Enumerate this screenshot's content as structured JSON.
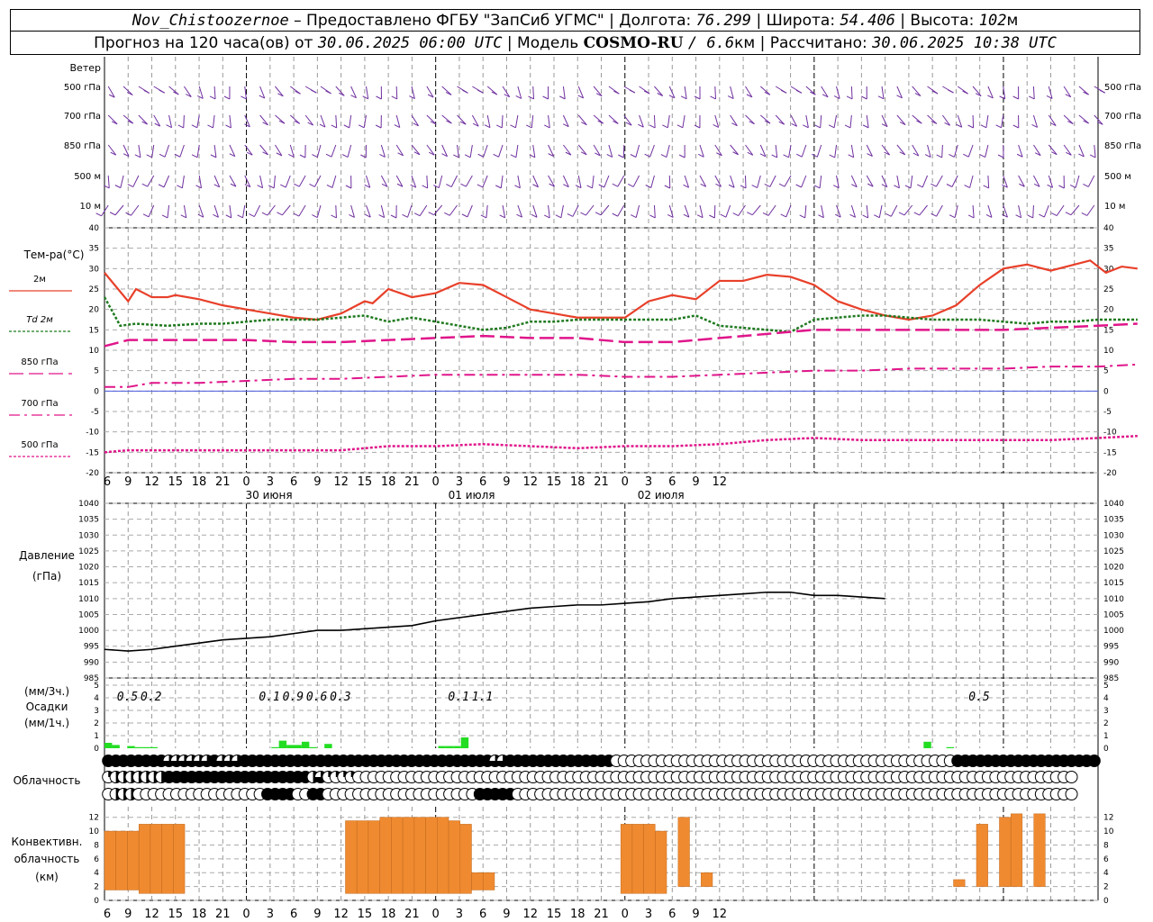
{
  "header": {
    "station": "Nov_Chistoozernoe",
    "provider": "– Предоставлено ФГБУ \"ЗапСиб УГМС\" |",
    "lon_label": "Долгота:",
    "lon_value": "76.299",
    "lat_label": "| Широта:",
    "lat_value": "54.406",
    "alt_label": "| Высота:",
    "alt_value": "102",
    "alt_unit": "м",
    "forecast_label": "Прогноз на 120 часа(ов) от",
    "forecast_from": "30.06.2025 06:00 UTC",
    "model_label": "| Модель",
    "model_name": "COSMO-RU",
    "model_res": "/ 6.6",
    "model_res_unit": "км",
    "calc_label": "| Рассчитано:",
    "calc_time": "30.06.2025 10:38 UTC"
  },
  "colors": {
    "wind": "#7030a0",
    "t2m": "#e8402a",
    "td2m": "#1f7a1f",
    "t850": "#e0158a",
    "t700": "#e0158a",
    "t500": "#e0158a",
    "precip": "#22dd22",
    "convective": "#f08a30",
    "pressure": "#000000",
    "zero_line": "#4a5ae0"
  },
  "chart_data": {
    "type": "meteogram",
    "hour_ticks": [
      "6",
      "9",
      "12",
      "15",
      "18",
      "21",
      "0",
      "3",
      "6",
      "9",
      "12",
      "15",
      "18",
      "21",
      "0",
      "3",
      "6",
      "9",
      "12",
      "15",
      "18",
      "21",
      "0",
      "3",
      "6",
      "9",
      "12"
    ],
    "day_labels": [
      {
        "text": "30 июня",
        "hour": 6
      },
      {
        "text": "01 июля",
        "hour": 42
      },
      {
        "text": "02 июля",
        "hour": 66
      }
    ],
    "wind_panel": {
      "title": "Ветер",
      "levels": [
        "500 гПа",
        "700 гПа",
        "850 гПа",
        "500 м",
        "10  м"
      ]
    },
    "temperature": {
      "title": "Тем-ра(°С)",
      "ylim": [
        -20,
        40
      ],
      "ticks": [
        40,
        35,
        30,
        25,
        20,
        15,
        10,
        5,
        0,
        -5,
        -10,
        -15,
        -20
      ],
      "series": [
        {
          "name": "2м",
          "style": "solid",
          "points": [
            [
              0,
              29
            ],
            [
              3,
              22
            ],
            [
              4,
              25
            ],
            [
              6,
              23
            ],
            [
              8,
              23
            ],
            [
              9,
              23.5
            ],
            [
              12,
              22.5
            ],
            [
              15,
              21
            ],
            [
              18,
              20
            ],
            [
              21,
              19
            ],
            [
              24,
              18
            ],
            [
              27,
              17.5
            ],
            [
              30,
              19
            ],
            [
              33,
              22
            ],
            [
              34,
              21.5
            ],
            [
              36,
              25
            ],
            [
              39,
              23
            ],
            [
              42,
              24
            ],
            [
              45,
              26.5
            ],
            [
              48,
              26
            ],
            [
              51,
              23
            ],
            [
              54,
              20
            ],
            [
              57,
              19
            ],
            [
              60,
              18
            ],
            [
              63,
              18
            ],
            [
              66,
              18
            ],
            [
              69,
              22
            ],
            [
              72,
              23.5
            ],
            [
              75,
              22.5
            ],
            [
              78,
              27
            ],
            [
              81,
              27
            ],
            [
              84,
              28.5
            ],
            [
              87,
              28
            ],
            [
              90,
              26
            ],
            [
              93,
              22
            ],
            [
              96,
              20
            ],
            [
              99,
              18.5
            ],
            [
              102,
              17.5
            ],
            [
              105,
              18.5
            ],
            [
              108,
              21
            ],
            [
              111,
              26
            ],
            [
              114,
              30
            ],
            [
              117,
              31
            ],
            [
              120,
              29.5
            ],
            [
              123,
              31
            ],
            [
              125,
              32
            ],
            [
              127,
              29
            ],
            [
              129,
              30.5
            ],
            [
              131,
              30
            ]
          ]
        },
        {
          "name": "Td  2м",
          "style": "dotted",
          "points": [
            [
              0,
              23
            ],
            [
              2,
              16
            ],
            [
              4,
              16.5
            ],
            [
              8,
              16
            ],
            [
              12,
              16.5
            ],
            [
              15,
              16.5
            ],
            [
              18,
              17
            ],
            [
              21,
              17.5
            ],
            [
              24,
              17.5
            ],
            [
              27,
              17.5
            ],
            [
              30,
              18
            ],
            [
              33,
              18.5
            ],
            [
              36,
              17
            ],
            [
              39,
              18
            ],
            [
              42,
              17
            ],
            [
              45,
              16
            ],
            [
              48,
              15
            ],
            [
              51,
              15.5
            ],
            [
              54,
              17
            ],
            [
              57,
              17
            ],
            [
              60,
              17.5
            ],
            [
              63,
              17.5
            ],
            [
              66,
              17.5
            ],
            [
              69,
              17.5
            ],
            [
              72,
              17.5
            ],
            [
              75,
              18.5
            ],
            [
              78,
              16
            ],
            [
              81,
              15.5
            ],
            [
              84,
              15
            ],
            [
              87,
              14.5
            ],
            [
              90,
              17.5
            ],
            [
              93,
              18
            ],
            [
              96,
              18.5
            ],
            [
              99,
              18.5
            ],
            [
              102,
              18
            ],
            [
              105,
              17.5
            ],
            [
              108,
              17.5
            ],
            [
              111,
              17.5
            ],
            [
              114,
              17
            ],
            [
              117,
              16.5
            ],
            [
              120,
              17
            ],
            [
              123,
              17
            ],
            [
              126,
              17.5
            ],
            [
              131,
              17.5
            ]
          ]
        },
        {
          "name": "850 гПа",
          "style": "longdash",
          "points": [
            [
              0,
              11
            ],
            [
              3,
              12.5
            ],
            [
              6,
              12.5
            ],
            [
              12,
              12.5
            ],
            [
              18,
              12.5
            ],
            [
              24,
              12
            ],
            [
              30,
              12
            ],
            [
              36,
              12.5
            ],
            [
              42,
              13
            ],
            [
              48,
              13.5
            ],
            [
              54,
              13
            ],
            [
              60,
              13
            ],
            [
              66,
              12
            ],
            [
              72,
              12
            ],
            [
              78,
              13
            ],
            [
              84,
              14
            ],
            [
              90,
              15
            ],
            [
              96,
              15
            ],
            [
              102,
              15
            ],
            [
              108,
              15
            ],
            [
              114,
              15
            ],
            [
              120,
              15.5
            ],
            [
              126,
              16
            ],
            [
              131,
              16.5
            ]
          ]
        },
        {
          "name": "700 гПа",
          "style": "dashdot",
          "points": [
            [
              0,
              1
            ],
            [
              3,
              1
            ],
            [
              6,
              2
            ],
            [
              12,
              2
            ],
            [
              18,
              2.5
            ],
            [
              24,
              3
            ],
            [
              30,
              3
            ],
            [
              36,
              3.5
            ],
            [
              42,
              4
            ],
            [
              48,
              4
            ],
            [
              54,
              4
            ],
            [
              60,
              4
            ],
            [
              66,
              3.5
            ],
            [
              72,
              3.5
            ],
            [
              78,
              4
            ],
            [
              84,
              4.5
            ],
            [
              90,
              5
            ],
            [
              96,
              5
            ],
            [
              102,
              5.5
            ],
            [
              108,
              5.5
            ],
            [
              114,
              5.5
            ],
            [
              120,
              6
            ],
            [
              126,
              6
            ],
            [
              131,
              6.5
            ]
          ]
        },
        {
          "name": "500 гПа",
          "style": "dotted",
          "points": [
            [
              0,
              -15
            ],
            [
              3,
              -14.5
            ],
            [
              6,
              -14.5
            ],
            [
              12,
              -14.5
            ],
            [
              18,
              -14.5
            ],
            [
              24,
              -14.5
            ],
            [
              30,
              -14.5
            ],
            [
              36,
              -13.5
            ],
            [
              42,
              -13.5
            ],
            [
              48,
              -13
            ],
            [
              54,
              -13.5
            ],
            [
              60,
              -14
            ],
            [
              66,
              -13.5
            ],
            [
              72,
              -13.5
            ],
            [
              78,
              -13
            ],
            [
              84,
              -12
            ],
            [
              90,
              -11.5
            ],
            [
              96,
              -12
            ],
            [
              102,
              -12
            ],
            [
              108,
              -12
            ],
            [
              114,
              -12
            ],
            [
              120,
              -12
            ],
            [
              126,
              -11.5
            ],
            [
              131,
              -11
            ]
          ]
        }
      ]
    },
    "pressure": {
      "title": "Давление",
      "unit": "(гПа)",
      "ylim": [
        985,
        1040
      ],
      "ticks": [
        1040,
        1035,
        1030,
        1025,
        1020,
        1015,
        1010,
        1005,
        1000,
        995,
        990,
        985
      ],
      "points": [
        [
          0,
          994
        ],
        [
          3,
          993.5
        ],
        [
          6,
          994
        ],
        [
          9,
          995
        ],
        [
          12,
          996
        ],
        [
          15,
          997
        ],
        [
          18,
          997.5
        ],
        [
          21,
          998
        ],
        [
          24,
          999
        ],
        [
          27,
          1000
        ],
        [
          30,
          1000
        ],
        [
          33,
          1000.5
        ],
        [
          36,
          1001
        ],
        [
          39,
          1001.5
        ],
        [
          42,
          1003
        ],
        [
          45,
          1004
        ],
        [
          48,
          1005
        ],
        [
          51,
          1006
        ],
        [
          54,
          1007
        ],
        [
          57,
          1007.5
        ],
        [
          60,
          1008
        ],
        [
          63,
          1008
        ],
        [
          66,
          1008.5
        ],
        [
          69,
          1009
        ],
        [
          72,
          1010
        ],
        [
          75,
          1010.5
        ],
        [
          78,
          1011
        ],
        [
          81,
          1011.5
        ],
        [
          84,
          1012
        ],
        [
          87,
          1012
        ],
        [
          90,
          1011
        ],
        [
          93,
          1011
        ],
        [
          96,
          1010.5
        ],
        [
          99,
          1010
        ]
      ]
    },
    "precipitation": {
      "unit_3h": "(мм/3ч.)",
      "title": "Осадки",
      "unit_1h": "(мм/1ч.)",
      "ylim": [
        0,
        5
      ],
      "ticks": [
        5,
        4,
        3,
        2,
        1,
        0
      ],
      "totals": [
        {
          "hour": 2,
          "value": "0.5"
        },
        {
          "hour": 5,
          "value": "0.2"
        },
        {
          "hour": 20,
          "value": "0.1"
        },
        {
          "hour": 23,
          "value": "0.9"
        },
        {
          "hour": 26,
          "value": "0.6"
        },
        {
          "hour": 29,
          "value": "0.3"
        },
        {
          "hour": 44,
          "value": "0.1"
        },
        {
          "hour": 47,
          "value": "1.1"
        },
        {
          "hour": 110,
          "value": "0.5"
        }
      ],
      "bars": [
        [
          0,
          0.5
        ],
        [
          1,
          0.3
        ],
        [
          3,
          0.2
        ],
        [
          4,
          0.1
        ],
        [
          5,
          0.1
        ],
        [
          6,
          0.1
        ],
        [
          22,
          0.1
        ],
        [
          23,
          0.7
        ],
        [
          24,
          0.3
        ],
        [
          25,
          0.3
        ],
        [
          26,
          0.6
        ],
        [
          27,
          0.1
        ],
        [
          28,
          0.0
        ],
        [
          29,
          0.4
        ],
        [
          44,
          0.2
        ],
        [
          45,
          0.2
        ],
        [
          46,
          0.2
        ],
        [
          47,
          1.0
        ],
        [
          108,
          0.6
        ],
        [
          111,
          0.1
        ]
      ]
    },
    "cloudiness": {
      "title": "Облачность",
      "rows": [
        "88888888676666877788888888888888888888888888888888866888888888888880000000000000000000000000000000000000000000008888888888888888888",
        "34444444888888888888888888846322200000000000000000000000000000000000000000000000000000000000000000000000000000000000000000000000",
        "04440000000000000000088880088000000000000000000008888800000000000000000000000000000000000000000000000000000000000000000000000000"
      ]
    },
    "convective": {
      "title": "Конвективн.",
      "title2": "облачность",
      "unit": "(км)",
      "ylim": [
        0,
        13
      ],
      "ticks": [
        12,
        10,
        8,
        6,
        4,
        2,
        0
      ],
      "bars": [
        [
          0,
          1.5,
          10
        ],
        [
          1,
          1.5,
          10
        ],
        [
          2,
          1.5,
          10
        ],
        [
          3,
          1,
          11
        ],
        [
          4,
          1,
          11
        ],
        [
          5,
          1,
          11
        ],
        [
          6,
          1,
          11
        ],
        [
          21,
          1,
          11.5
        ],
        [
          22,
          1,
          11.5
        ],
        [
          23,
          1,
          11.5
        ],
        [
          24,
          1,
          12
        ],
        [
          25,
          1,
          12
        ],
        [
          26,
          1,
          12
        ],
        [
          27,
          1,
          12
        ],
        [
          28,
          1,
          12
        ],
        [
          29,
          1,
          12
        ],
        [
          30,
          1,
          11.5
        ],
        [
          31,
          1,
          11
        ],
        [
          32,
          1.5,
          4
        ],
        [
          33,
          1.5,
          4
        ],
        [
          34,
          2,
          2
        ],
        [
          45,
          1,
          11
        ],
        [
          46,
          1,
          11
        ],
        [
          47,
          1,
          11
        ],
        [
          48,
          1,
          10
        ],
        [
          50,
          2,
          12
        ],
        [
          51,
          2,
          2
        ],
        [
          52,
          2,
          4
        ],
        [
          74,
          2,
          3
        ],
        [
          76,
          2,
          11
        ],
        [
          78,
          2,
          12
        ],
        [
          79,
          2,
          12.5
        ],
        [
          81,
          2,
          12.5
        ]
      ]
    }
  }
}
